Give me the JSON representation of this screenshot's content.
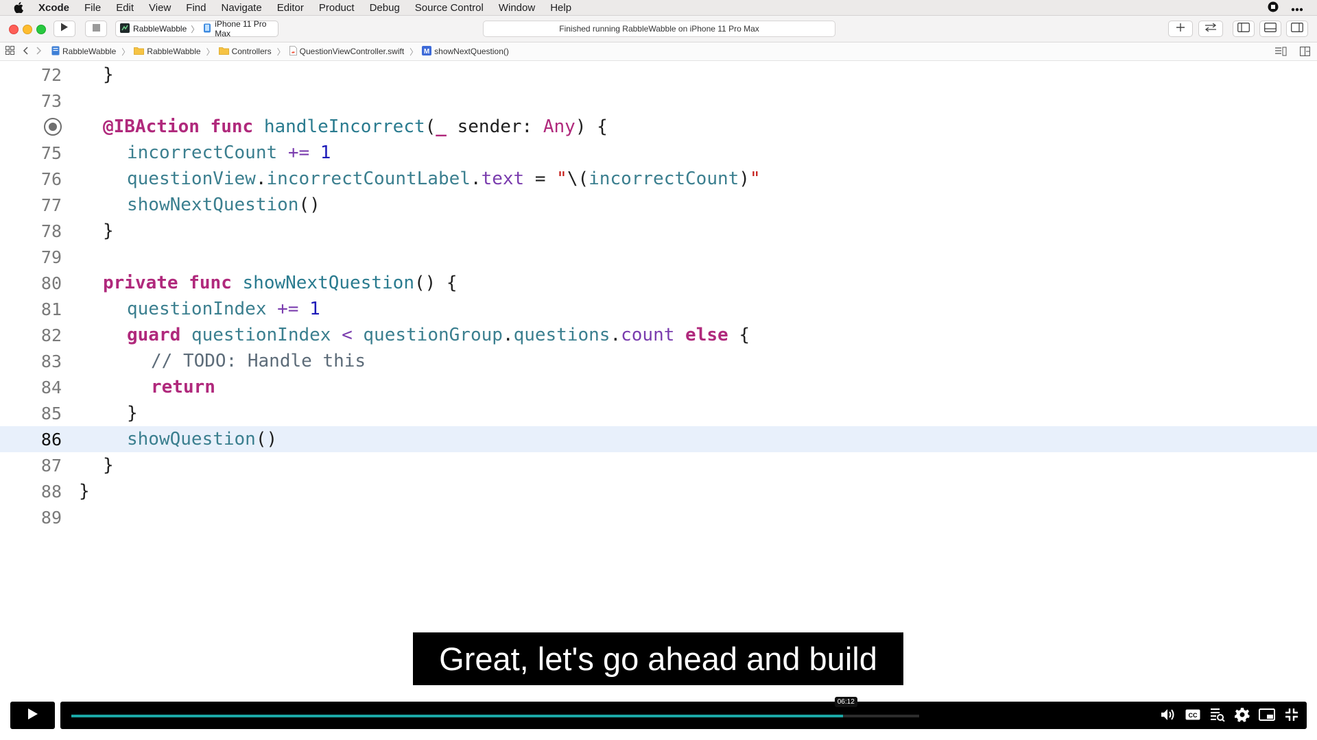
{
  "menubar": {
    "app": "Xcode",
    "items": [
      "File",
      "Edit",
      "View",
      "Find",
      "Navigate",
      "Editor",
      "Product",
      "Debug",
      "Source Control",
      "Window",
      "Help"
    ]
  },
  "toolbar": {
    "scheme_target": "RabbleWabble",
    "scheme_device": "iPhone 11 Pro Max",
    "status": "Finished running RabbleWabble on iPhone 11 Pro Max"
  },
  "jumpbar": {
    "crumbs": [
      "RabbleWabble",
      "RabbleWabble",
      "Controllers",
      "QuestionViewController.swift",
      "showNextQuestion()"
    ]
  },
  "editor": {
    "current_line": 86,
    "lines": [
      {
        "num": "72",
        "text": "  }"
      },
      {
        "num": "73",
        "text": ""
      },
      {
        "num": "",
        "text": "  @IBAction func handleIncorrect(_ sender: Any) {",
        "breakpoint": true
      },
      {
        "num": "75",
        "text": "    incorrectCount += 1"
      },
      {
        "num": "76",
        "text": "    questionView.incorrectCountLabel.text = \"\\(incorrectCount)\""
      },
      {
        "num": "77",
        "text": "    showNextQuestion()"
      },
      {
        "num": "78",
        "text": "  }"
      },
      {
        "num": "79",
        "text": ""
      },
      {
        "num": "80",
        "text": "  private func showNextQuestion() {"
      },
      {
        "num": "81",
        "text": "    questionIndex += 1"
      },
      {
        "num": "82",
        "text": "    guard questionIndex < questionGroup.questions.count else {"
      },
      {
        "num": "83",
        "text": "      // TODO: Handle this"
      },
      {
        "num": "84",
        "text": "      return"
      },
      {
        "num": "85",
        "text": "    }"
      },
      {
        "num": "86",
        "text": "    showQuestion()"
      },
      {
        "num": "87",
        "text": "  }"
      },
      {
        "num": "88",
        "text": "}"
      },
      {
        "num": "89",
        "text": ""
      }
    ]
  },
  "subtitle": "Great, let's go ahead and build",
  "player": {
    "time": "06:12",
    "progress": 0.91,
    "accent": "#1aa7a5"
  },
  "colors": {
    "keyword": "#b0297c",
    "function": "#2a7b8f",
    "number": "#1c1ab8",
    "type": "#7a3cae",
    "string": "#c41a16",
    "comment": "#5d6c79",
    "current_line_bg": "#e8f0fb"
  }
}
